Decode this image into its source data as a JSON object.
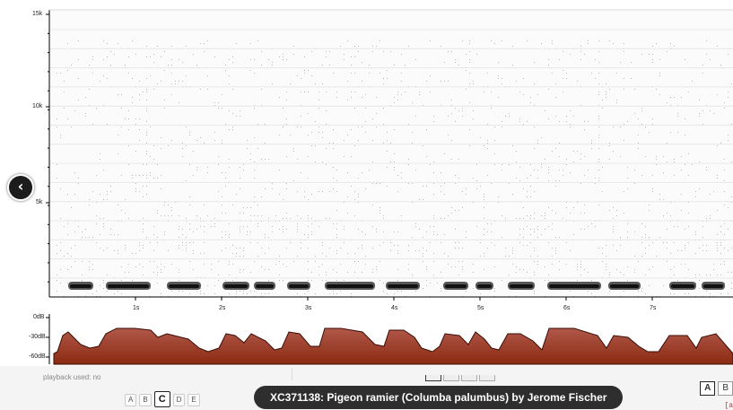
{
  "spectrogram": {
    "y_axis_labels": [
      "15k",
      "10k",
      "5k"
    ],
    "x_axis_labels": [
      "1s",
      "2s",
      "3s",
      "4s",
      "5s",
      "6s",
      "7s"
    ],
    "duration_visible_s": 8.0,
    "freq_max_hz": 15000
  },
  "waveform": {
    "y_axis_labels": [
      "0dB",
      "-30dB",
      "-60dB"
    ],
    "fill_color": "#8b2a12"
  },
  "nav": {
    "prev_icon": "chevron-left-icon",
    "prev_glyph": "‹"
  },
  "playback": {
    "label": "playback used: no"
  },
  "display_modes": [
    "A",
    "B",
    "C",
    "D",
    "E"
  ],
  "display_mode_selected": "C",
  "caption": "XC371138: Pigeon ramier (Columba palumbus) by Jerome Fischer",
  "quality_buttons": [
    "A",
    "B"
  ],
  "quality_selected": "A",
  "corner_mark": "[a"
}
